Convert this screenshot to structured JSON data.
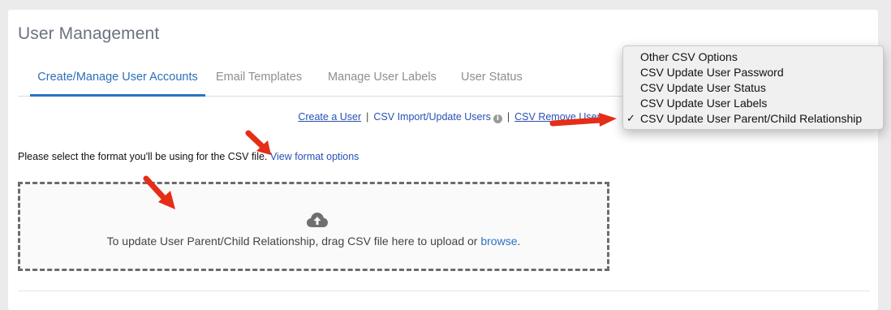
{
  "page": {
    "title": "User Management"
  },
  "tabs": [
    {
      "label": "Create/Manage User Accounts",
      "active": true
    },
    {
      "label": "Email Templates",
      "active": false
    },
    {
      "label": "Manage User Labels",
      "active": false
    },
    {
      "label": "User Status",
      "active": false
    }
  ],
  "action_links": {
    "create_user": "Create a User",
    "separator": "|",
    "csv_import": "CSV Import/Update Users",
    "csv_remove": "CSV Remove Users"
  },
  "instruction": {
    "text": "Please select the format you'll be using for the CSV file.",
    "link": "View format options"
  },
  "dropzone": {
    "text": "To update User Parent/Child Relationship, drag CSV file here to upload or",
    "browse": "browse",
    "period": ".",
    "icon": "cloud-upload-icon"
  },
  "dropdown": {
    "options": [
      {
        "label": "Other CSV Options",
        "selected": false
      },
      {
        "label": "CSV Update User Password",
        "selected": false
      },
      {
        "label": "CSV Update User Status",
        "selected": false
      },
      {
        "label": "CSV Update User Labels",
        "selected": false
      },
      {
        "label": "CSV Update User Parent/Child Relationship",
        "selected": true
      }
    ],
    "checkmark": "✓"
  },
  "colors": {
    "accent": "#2a73c2",
    "link": "#2850b5",
    "annotation_arrow": "#e52d17"
  }
}
